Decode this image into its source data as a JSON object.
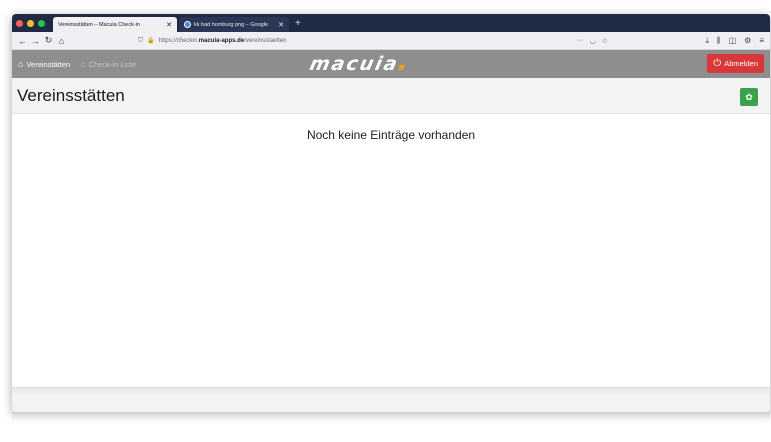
{
  "browser": {
    "tabs": [
      {
        "label": "Vereinsstätten – Macuia Check-in"
      },
      {
        "label": "kk bad homburg png – Google"
      }
    ],
    "url": {
      "prefix": "https://checkin.",
      "host": "macuia-apps.de",
      "path": "/vereinsstaetten"
    }
  },
  "app": {
    "nav": [
      {
        "label": "Vereinstätten"
      },
      {
        "label": "Check-in Liste"
      }
    ],
    "brand": "macuia",
    "logout_label": "Abmelden"
  },
  "page": {
    "title": "Vereinsstätten",
    "empty_message": "Noch keine Einträge vorhanden"
  },
  "colors": {
    "header_bg": "#8e8e8e",
    "logout_bg": "#d9383a",
    "add_button_bg": "#3aa24a",
    "brand_accent": "#f0a020"
  }
}
